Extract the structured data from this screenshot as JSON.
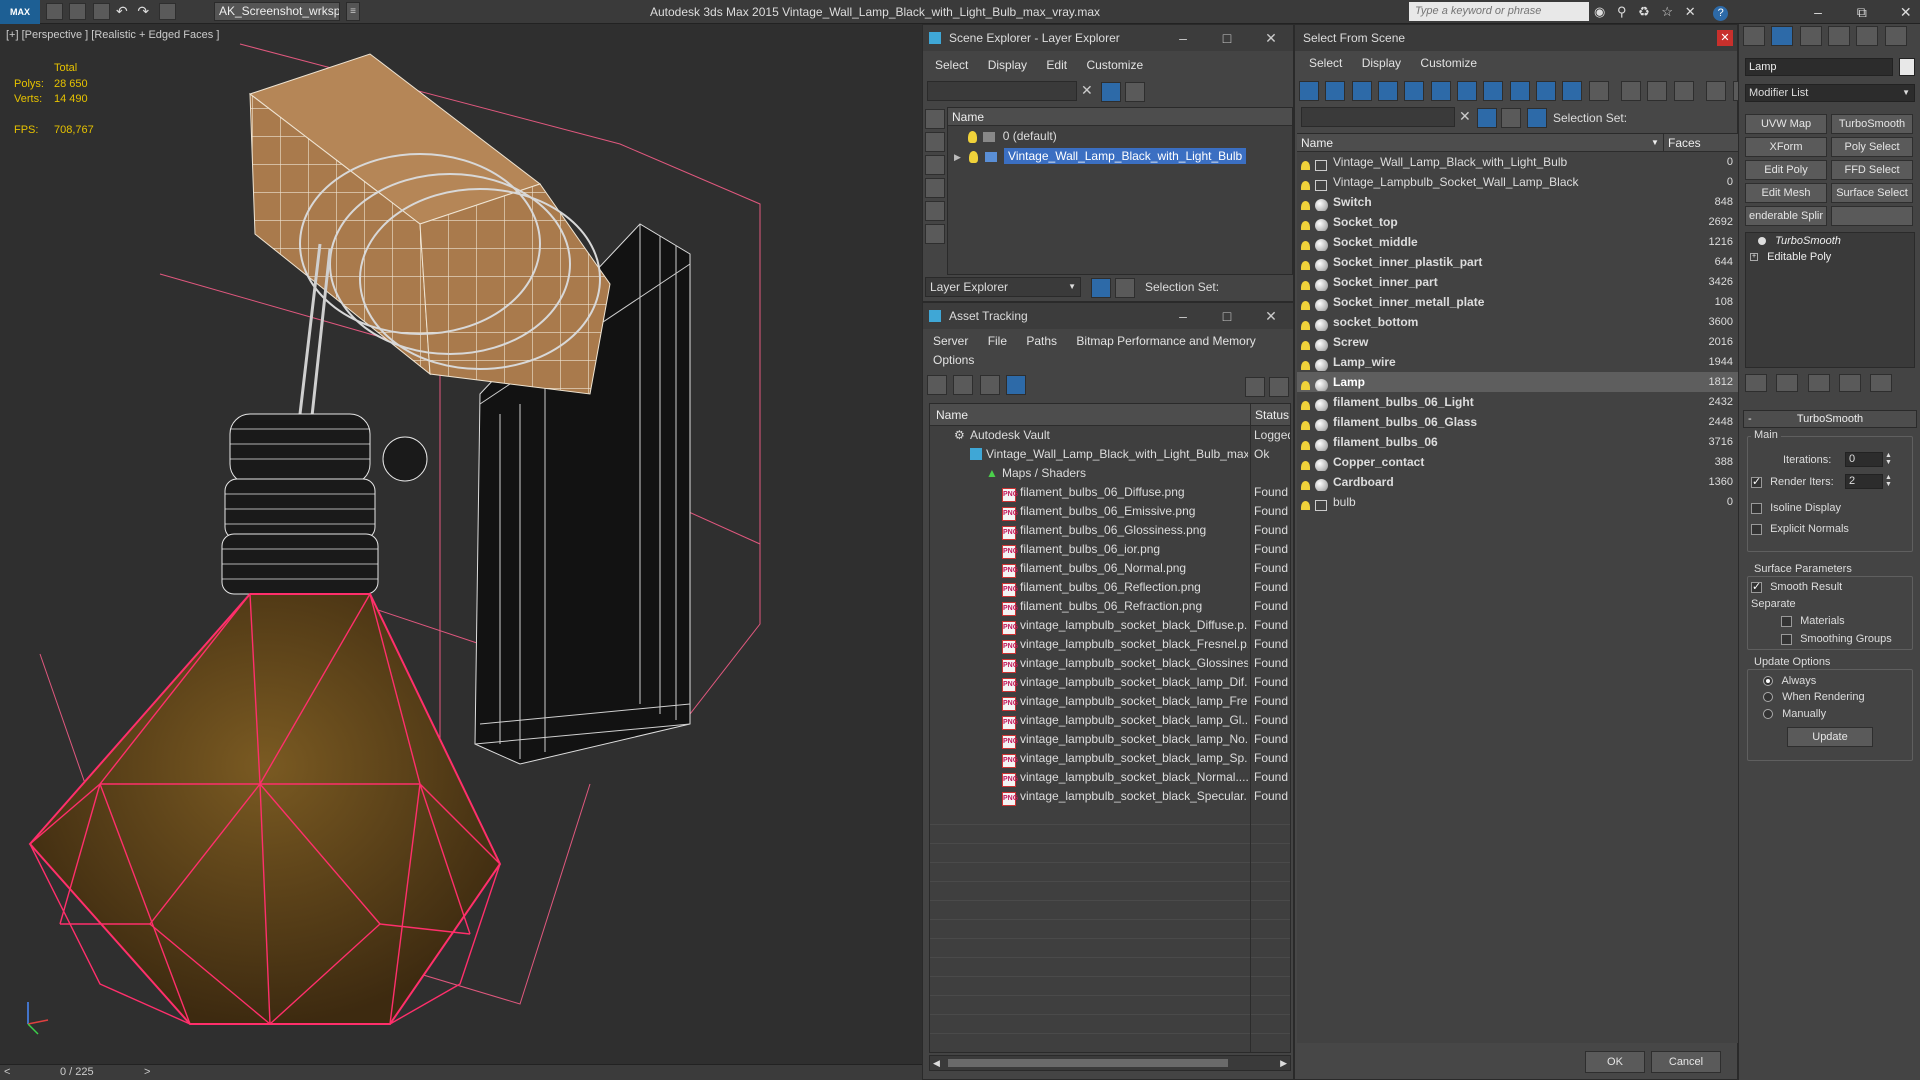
{
  "app": {
    "logo": "MAX",
    "workspace": "AK_Screenshot_wrksp",
    "title": "Autodesk 3ds Max  2015    Vintage_Wall_Lamp_Black_with_Light_Bulb_max_vray.max",
    "search_placeholder": "Type a keyword or phrase"
  },
  "viewport": {
    "label": "[+] [Perspective ] [Realistic + Edged Faces ]",
    "stats": {
      "total_label": "Total",
      "polys_label": "Polys:",
      "polys_value": "28 650",
      "verts_label": "Verts:",
      "verts_value": "14 490",
      "fps_label": "FPS:",
      "fps_value": "708,767"
    },
    "timeline": "0 / 225",
    "prev": "<",
    "next": ">"
  },
  "scene_explorer": {
    "title": "Scene Explorer - Layer Explorer",
    "menu": [
      "Select",
      "Display",
      "Edit",
      "Customize"
    ],
    "column": "Name",
    "rows": [
      {
        "label": "0 (default)",
        "selected": false
      },
      {
        "label": "Vintage_Wall_Lamp_Black_with_Light_Bulb",
        "selected": true
      }
    ],
    "layer_dropdown": "Layer Explorer",
    "selection_set_label": "Selection Set:"
  },
  "asset_tracking": {
    "title": "Asset Tracking",
    "menu": [
      "Server",
      "File",
      "Paths",
      "Bitmap Performance and Memory"
    ],
    "menu2": [
      "Options"
    ],
    "col_name": "Name",
    "col_status": "Status",
    "vault": {
      "name": "Autodesk Vault",
      "status": "Logged"
    },
    "file": {
      "name": "Vintage_Wall_Lamp_Black_with_Light_Bulb_max...",
      "status": "Ok"
    },
    "folder": {
      "name": "Maps / Shaders",
      "status": ""
    },
    "png_label": "PNG",
    "items": [
      {
        "name": "filament_bulbs_06_Diffuse.png",
        "status": "Found"
      },
      {
        "name": "filament_bulbs_06_Emissive.png",
        "status": "Found"
      },
      {
        "name": "filament_bulbs_06_Glossiness.png",
        "status": "Found"
      },
      {
        "name": "filament_bulbs_06_ior.png",
        "status": "Found"
      },
      {
        "name": "filament_bulbs_06_Normal.png",
        "status": "Found"
      },
      {
        "name": "filament_bulbs_06_Reflection.png",
        "status": "Found"
      },
      {
        "name": "filament_bulbs_06_Refraction.png",
        "status": "Found"
      },
      {
        "name": "vintage_lampbulb_socket_black_Diffuse.p...",
        "status": "Found"
      },
      {
        "name": "vintage_lampbulb_socket_black_Fresnel.p...",
        "status": "Found"
      },
      {
        "name": "vintage_lampbulb_socket_black_Glossines...",
        "status": "Found"
      },
      {
        "name": "vintage_lampbulb_socket_black_lamp_Dif...",
        "status": "Found"
      },
      {
        "name": "vintage_lampbulb_socket_black_lamp_Fre...",
        "status": "Found"
      },
      {
        "name": "vintage_lampbulb_socket_black_lamp_Gl...",
        "status": "Found"
      },
      {
        "name": "vintage_lampbulb_socket_black_lamp_No...",
        "status": "Found"
      },
      {
        "name": "vintage_lampbulb_socket_black_lamp_Sp...",
        "status": "Found"
      },
      {
        "name": "vintage_lampbulb_socket_black_Normal....",
        "status": "Found"
      },
      {
        "name": "vintage_lampbulb_socket_black_Specular....",
        "status": "Found"
      }
    ]
  },
  "select_from_scene": {
    "title": "Select From Scene",
    "menu": [
      "Select",
      "Display",
      "Customize"
    ],
    "selection_set_label": "Selection Set:",
    "col_name": "Name",
    "col_faces": "Faces",
    "rows": [
      {
        "name": "Vintage_Wall_Lamp_Black_with_Light_Bulb",
        "faces": "0",
        "kind": "group",
        "bold": false,
        "selected": false
      },
      {
        "name": "Vintage_Lampbulb_Socket_Wall_Lamp_Black",
        "faces": "0",
        "kind": "group",
        "bold": false,
        "selected": false
      },
      {
        "name": "Switch",
        "faces": "848",
        "kind": "mesh",
        "bold": true,
        "selected": false
      },
      {
        "name": "Socket_top",
        "faces": "2692",
        "kind": "mesh",
        "bold": true,
        "selected": false
      },
      {
        "name": "Socket_middle",
        "faces": "1216",
        "kind": "mesh",
        "bold": true,
        "selected": false
      },
      {
        "name": "Socket_inner_plastik_part",
        "faces": "644",
        "kind": "mesh",
        "bold": true,
        "selected": false
      },
      {
        "name": "Socket_inner_part",
        "faces": "3426",
        "kind": "mesh",
        "bold": true,
        "selected": false
      },
      {
        "name": "Socket_inner_metall_plate",
        "faces": "108",
        "kind": "mesh",
        "bold": true,
        "selected": false
      },
      {
        "name": "socket_bottom",
        "faces": "3600",
        "kind": "mesh",
        "bold": true,
        "selected": false
      },
      {
        "name": "Screw",
        "faces": "2016",
        "kind": "mesh",
        "bold": true,
        "selected": false
      },
      {
        "name": "Lamp_wire",
        "faces": "1944",
        "kind": "mesh",
        "bold": true,
        "selected": false
      },
      {
        "name": "Lamp",
        "faces": "1812",
        "kind": "mesh",
        "bold": true,
        "selected": true
      },
      {
        "name": "filament_bulbs_06_Light",
        "faces": "2432",
        "kind": "mesh",
        "bold": true,
        "selected": false
      },
      {
        "name": "filament_bulbs_06_Glass",
        "faces": "2448",
        "kind": "mesh",
        "bold": true,
        "selected": false
      },
      {
        "name": "filament_bulbs_06",
        "faces": "3716",
        "kind": "mesh",
        "bold": true,
        "selected": false
      },
      {
        "name": "Copper_contact",
        "faces": "388",
        "kind": "mesh",
        "bold": true,
        "selected": false
      },
      {
        "name": "Cardboard",
        "faces": "1360",
        "kind": "mesh",
        "bold": true,
        "selected": false
      },
      {
        "name": "bulb",
        "faces": "0",
        "kind": "group",
        "bold": false,
        "selected": false
      }
    ],
    "ok": "OK",
    "cancel": "Cancel"
  },
  "modify_panel": {
    "object_name": "Lamp",
    "modifier_list": "Modifier List",
    "buttons": [
      "UVW Map",
      "TurboSmooth",
      "XForm",
      "Poly Select",
      "Edit Poly",
      "FFD Select",
      "Edit Mesh",
      "Surface Select",
      "enderable Splir",
      ""
    ],
    "stack": [
      {
        "label": "TurboSmooth",
        "italic": true
      },
      {
        "label": "Editable Poly",
        "italic": false
      }
    ],
    "rollout_title": "TurboSmooth",
    "main_label": "Main",
    "iterations_label": "Iterations:",
    "iterations_value": "0",
    "render_iters_label": "Render Iters:",
    "render_iters_value": "2",
    "render_iters_checked": true,
    "isoline_label": "Isoline Display",
    "explicit_label": "Explicit Normals",
    "surface_params_label": "Surface Parameters",
    "smooth_result_label": "Smooth Result",
    "separate_label": "Separate",
    "materials_label": "Materials",
    "smoothing_groups_label": "Smoothing Groups",
    "update_options_label": "Update Options",
    "always_label": "Always",
    "when_rendering_label": "When Rendering",
    "manually_label": "Manually",
    "update_button": "Update"
  },
  "colors": {
    "selection_blue": "#3b6fc2",
    "wire_pink": "#ff2f6b",
    "stat_yellow": "#e6c200"
  }
}
